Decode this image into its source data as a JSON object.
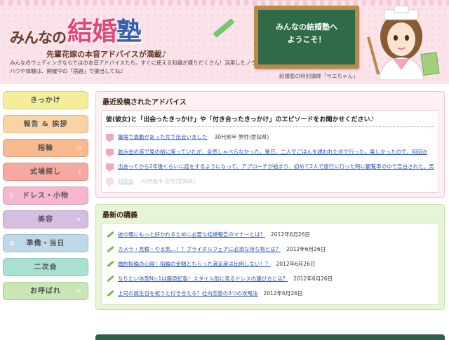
{
  "header": {
    "site_title_pre": "みんなの",
    "site_title_main_1": "結",
    "site_title_main_2": "婚",
    "site_title_main_3": "塾",
    "tagline": "先輩花嫁の本音アドバイスが満載♪",
    "intro": "みんなのウェディングならではの本音アドバイスたち。すぐに使える知識が盛りだくさん！活用したノウハウや体験は、開催中の「宿題」で提出してね♪",
    "board_line1": "みんなの結婚塾へ",
    "board_line2": "ようこそ！",
    "caption": "結婚塾の特別講師「サエちゃん」"
  },
  "sidebar": {
    "items": [
      {
        "label": "きっかけ",
        "color": "#f4ee9c"
      },
      {
        "label": "報告 & 挨拶",
        "color": "#f9d3a4"
      },
      {
        "label": "指輪",
        "color": "#f8b98e"
      },
      {
        "label": "式場探し",
        "color": "#f6a9a0"
      },
      {
        "label": "ドレス・小物",
        "color": "#f6b6d0"
      },
      {
        "label": "美容",
        "color": "#d6bde2"
      },
      {
        "label": "準備・当日",
        "color": "#bdd8e6"
      },
      {
        "label": "二次会",
        "color": "#a8e0d2"
      },
      {
        "label": "お呼ばれ",
        "color": "#c8e7b4"
      }
    ]
  },
  "recent": {
    "heading": "最近投稿されたアドバイス",
    "question": "彼(彼女)と「出会ったきっかけ」や「付き合ったきっかけ」のエピソードをお聞かせください♪",
    "items": [
      {
        "text": "職場で異動があった先で出会いました",
        "meta": "30代前半 男性(愛知県)",
        "faded": false
      },
      {
        "text": "飲み会の席で見の前に座っていたが、全然しゃべらなかった。後日、二人でごはんを誘われたので行った。楽しかったので、何回か",
        "meta": "",
        "faded": false
      },
      {
        "text": "出会ってから2年後くらいに話をするようになって、アプローチが始まり、初めて2人で旅行に行った時に観覧車の中で告白された。男",
        "meta": "",
        "faded": false
      },
      {
        "text": "同窓会",
        "meta": "30代後半 女性(愛知県)",
        "faded": true
      }
    ]
  },
  "lectures": {
    "heading": "最新の講義",
    "items": [
      {
        "text": "彼の親にもっと好かれるために必要な結婚報告のマナーとは？",
        "date": "2012年6月26日"
      },
      {
        "text": "カメラ・見積・やる気…！？ブライダルフェアに必須な持ち物とは？",
        "date": "2012年6月26日"
      },
      {
        "text": "婚約指輪の心得！指輪の金額ともらった満足度は比例しない！？",
        "date": "2012年6月26日"
      },
      {
        "text": "なりたい体型No.1は藤原紀香！スタイル別に見るドレスの選び方とは？",
        "date": "2012年6月26日"
      },
      {
        "text": "上司の誕生日を祝うと付き合える？社内恋愛の3つの攻略法",
        "date": "2012年6月26日"
      }
    ]
  }
}
